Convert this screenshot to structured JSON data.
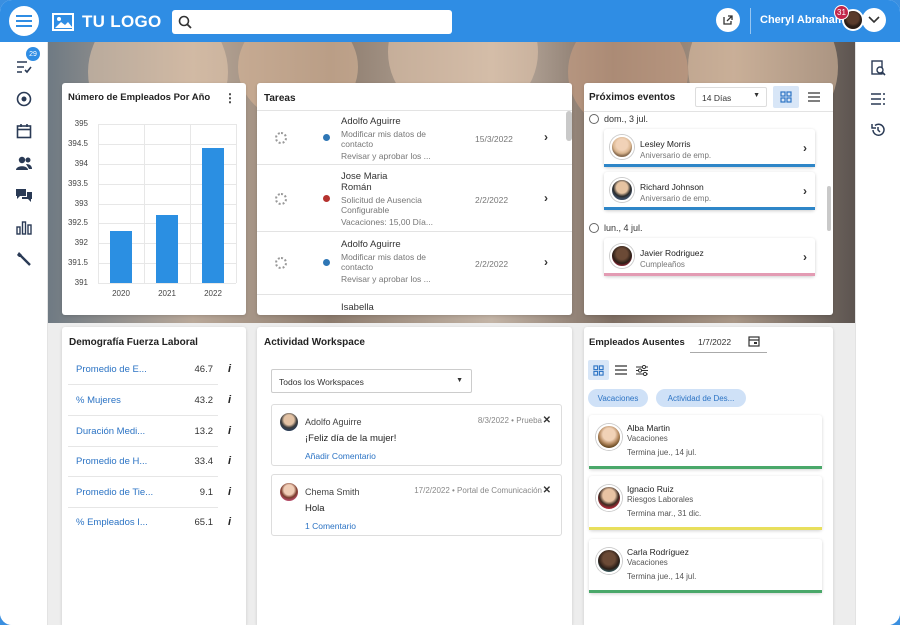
{
  "header": {
    "logo_text": "TU LOGO",
    "user_name": "Cheryl Abrahams",
    "user_badge": "31"
  },
  "sidebar": {
    "badge": "29"
  },
  "employees_chart": {
    "title": "Número de Empleados Por Año",
    "y_ticks": [
      "395",
      "394.5",
      "394",
      "393.5",
      "393",
      "392.5",
      "392",
      "391.5",
      "391"
    ],
    "x_ticks": [
      "2020",
      "2021",
      "2022"
    ]
  },
  "chart_data": {
    "type": "bar",
    "title": "Número de Empleados Por Año",
    "categories": [
      "2020",
      "2021",
      "2022"
    ],
    "values": [
      392.3,
      392.7,
      394.4
    ],
    "ylim": [
      391,
      395
    ],
    "grid": true
  },
  "tasks": {
    "title": "Tareas",
    "items": [
      {
        "name": "Adolfo Aguirre",
        "line1": "Modificar mis datos de",
        "line2": "contacto",
        "line3": "Revisar y aprobar los ...",
        "date": "15/3/2022",
        "dot": "#2e76b5"
      },
      {
        "name": "Jose Maria",
        "name2": "Román",
        "line1": "Solicitud de Ausencia",
        "line2": "Configurable",
        "line3": "Vacaciones: 15,00 Día...",
        "date": "2/2/2022",
        "dot": "#b5322e"
      },
      {
        "name": "Adolfo Aguirre",
        "line1": "Modificar mis datos de",
        "line2": "contacto",
        "line3": "Revisar y aprobar los ...",
        "date": "2/2/2022",
        "dot": "#2e76b5"
      },
      {
        "name": "Isabella"
      }
    ]
  },
  "events": {
    "title": "Próximos eventos",
    "range": "14 Días",
    "days": [
      {
        "date": "dom., 3 jul.",
        "people": [
          {
            "name": "Lesley Morris",
            "sub": "Aniversario de emp.",
            "color": "#2e86c8"
          },
          {
            "name": "Richard Johnson",
            "sub": "Aniversario de emp.",
            "color": "#2e86c8"
          }
        ]
      },
      {
        "date": "lun., 4 jul.",
        "people": [
          {
            "name": "Javier Rodriguez",
            "sub": "Cumpleaños",
            "color": "#e39bb3"
          }
        ]
      }
    ]
  },
  "demography": {
    "title": "Demografía Fuerza Laboral",
    "rows": [
      {
        "label": "Promedio de E...",
        "value": "46.7"
      },
      {
        "label": "% Mujeres",
        "value": "43.2"
      },
      {
        "label": "Duración Medi...",
        "value": "13.2"
      },
      {
        "label": "Promedio de H...",
        "value": "33.4"
      },
      {
        "label": "Promedio de Tie...",
        "value": "9.1"
      },
      {
        "label": "% Empleados I...",
        "value": "65.1"
      }
    ],
    "info_glyph": "i"
  },
  "workspace": {
    "title": "Actividad Workspace",
    "select": "Todos los Workspaces",
    "posts": [
      {
        "author": "Adolfo Aguirre",
        "meta": "8/3/2022 • Prueba",
        "text": "¡Feliz día de la mujer!",
        "link": "Añadir Comentario"
      },
      {
        "author": "Chema Smith",
        "meta": "17/2/2022 • Portal de Comunicación",
        "text": "Hola",
        "link": "1 Comentario"
      }
    ]
  },
  "absent": {
    "title": "Empleados Ausentes",
    "date": "1/7/2022",
    "chips": [
      "Vacaciones",
      "Actividad de Des..."
    ],
    "people": [
      {
        "name": "Alba Martin",
        "type": "Vacaciones",
        "end": "Termina jue., 14 jul.",
        "color": "#4aa86a"
      },
      {
        "name": "Ignacio Ruiz",
        "type": "Riesgos Laborales",
        "end": "Termina mar., 31 dic.",
        "color": "#e8df5c"
      },
      {
        "name": "Carla Rodríguez",
        "type": "Vacaciones",
        "end": "Termina jue., 14 jul.",
        "color": "#4aa86a"
      }
    ]
  }
}
